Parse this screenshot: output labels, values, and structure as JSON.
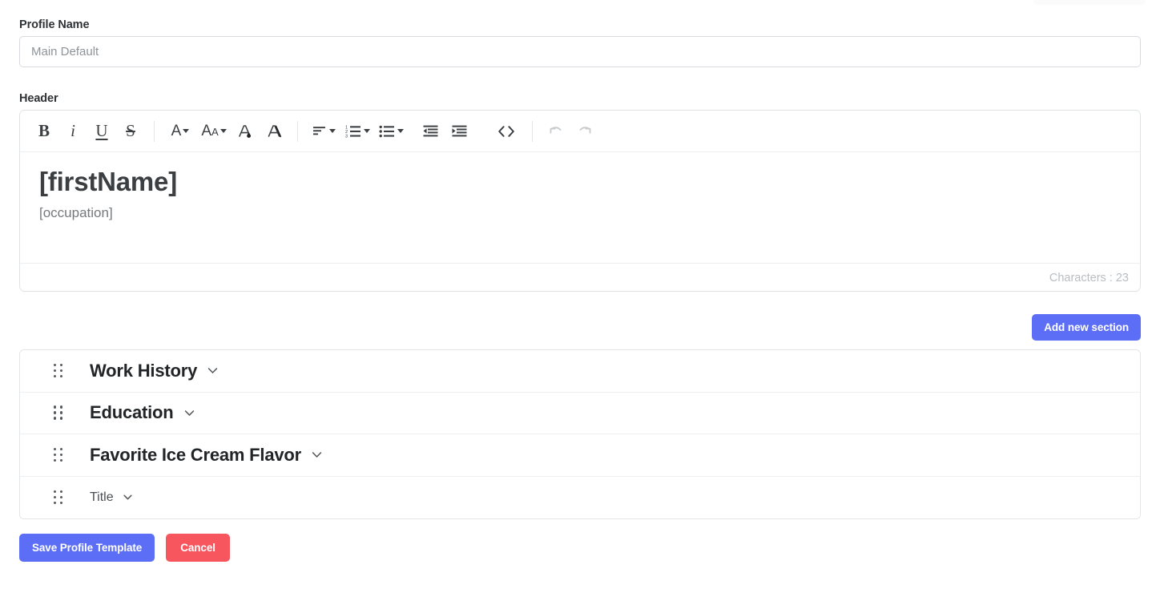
{
  "form": {
    "profile_name": {
      "label": "Profile Name",
      "value": "",
      "placeholder": "Main Default"
    },
    "header": {
      "label": "Header"
    }
  },
  "editor": {
    "toolbar": [
      {
        "name": "bold-icon",
        "label": "B",
        "title": "Bold",
        "interactable": true
      },
      {
        "name": "italic-icon",
        "label": "i",
        "title": "Italic",
        "interactable": true
      },
      {
        "name": "underline-icon",
        "label": "U",
        "title": "Underline",
        "interactable": true
      },
      {
        "name": "strikethrough-icon",
        "label": "S",
        "title": "Strikethrough",
        "interactable": true
      },
      {
        "name": "font-family-icon",
        "label": "A",
        "title": "Font Family",
        "interactable": true
      },
      {
        "name": "font-size-icon",
        "label": "AA",
        "title": "Font Size",
        "interactable": true
      },
      {
        "name": "text-color-icon",
        "label": "A",
        "title": "Text Color",
        "interactable": true
      },
      {
        "name": "clear-format-icon",
        "label": "A",
        "title": "Clear Formatting",
        "interactable": true
      },
      {
        "name": "align-icon",
        "label": "",
        "title": "Alignment",
        "interactable": true
      },
      {
        "name": "ordered-list-icon",
        "label": "",
        "title": "Ordered List",
        "interactable": true
      },
      {
        "name": "unordered-list-icon",
        "label": "",
        "title": "Unordered List",
        "interactable": true
      },
      {
        "name": "outdent-icon",
        "label": "",
        "title": "Outdent",
        "interactable": true
      },
      {
        "name": "indent-icon",
        "label": "",
        "title": "Indent",
        "interactable": true
      },
      {
        "name": "code-view-icon",
        "label": "<>",
        "title": "Code View",
        "interactable": true
      },
      {
        "name": "undo-icon",
        "label": "",
        "title": "Undo",
        "interactable": false
      },
      {
        "name": "redo-icon",
        "label": "",
        "title": "Redo",
        "interactable": false
      }
    ],
    "content": {
      "heading": "[firstName]",
      "subheading": "[occupation]"
    },
    "character_count": "Characters : 23"
  },
  "actions": {
    "add_new_section": "Add new section",
    "save_profile_template": "Save Profile Template",
    "cancel": "Cancel"
  },
  "sections": [
    {
      "title": "Work History",
      "style": "large"
    },
    {
      "title": "Education",
      "style": "large"
    },
    {
      "title": "Favorite Ice Cream Flavor",
      "style": "large"
    },
    {
      "title": "Title",
      "style": "small"
    }
  ],
  "colors": {
    "primary": "#5b6ef5",
    "danger": "#f8565f",
    "border": "#e3e6e9",
    "text": "#222527",
    "muted": "#b9bec2"
  }
}
